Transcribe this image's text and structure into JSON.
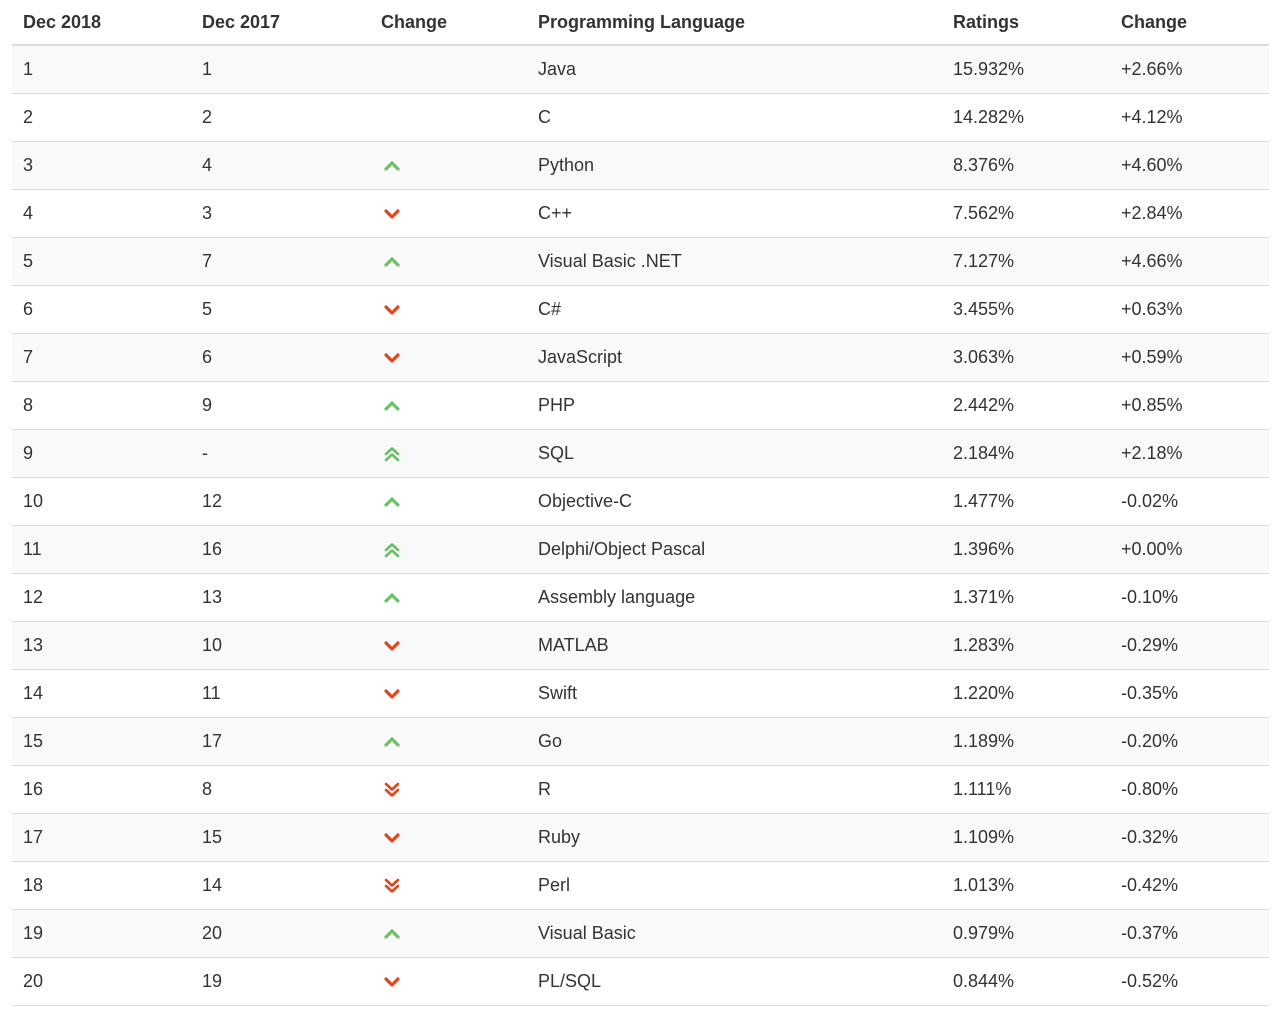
{
  "headers": [
    "Dec 2018",
    "Dec 2017",
    "Change",
    "Programming Language",
    "Ratings",
    "Change"
  ],
  "colors": {
    "up": "#6cbf6a",
    "down": "#e0461c"
  },
  "rows": [
    {
      "rank_2018": "1",
      "rank_2017": "1",
      "trend": "none",
      "language": "Java",
      "rating": "15.932%",
      "change": "+2.66%"
    },
    {
      "rank_2018": "2",
      "rank_2017": "2",
      "trend": "none",
      "language": "C",
      "rating": "14.282%",
      "change": "+4.12%"
    },
    {
      "rank_2018": "3",
      "rank_2017": "4",
      "trend": "up",
      "language": "Python",
      "rating": "8.376%",
      "change": "+4.60%"
    },
    {
      "rank_2018": "4",
      "rank_2017": "3",
      "trend": "down",
      "language": "C++",
      "rating": "7.562%",
      "change": "+2.84%"
    },
    {
      "rank_2018": "5",
      "rank_2017": "7",
      "trend": "up",
      "language": "Visual Basic .NET",
      "rating": "7.127%",
      "change": "+4.66%"
    },
    {
      "rank_2018": "6",
      "rank_2017": "5",
      "trend": "down",
      "language": "C#",
      "rating": "3.455%",
      "change": "+0.63%"
    },
    {
      "rank_2018": "7",
      "rank_2017": "6",
      "trend": "down",
      "language": "JavaScript",
      "rating": "3.063%",
      "change": "+0.59%"
    },
    {
      "rank_2018": "8",
      "rank_2017": "9",
      "trend": "up",
      "language": "PHP",
      "rating": "2.442%",
      "change": "+0.85%"
    },
    {
      "rank_2018": "9",
      "rank_2017": "-",
      "trend": "up-double",
      "language": "SQL",
      "rating": "2.184%",
      "change": "+2.18%"
    },
    {
      "rank_2018": "10",
      "rank_2017": "12",
      "trend": "up",
      "language": "Objective-C",
      "rating": "1.477%",
      "change": "-0.02%"
    },
    {
      "rank_2018": "11",
      "rank_2017": "16",
      "trend": "up-double",
      "language": "Delphi/Object Pascal",
      "rating": "1.396%",
      "change": "+0.00%"
    },
    {
      "rank_2018": "12",
      "rank_2017": "13",
      "trend": "up",
      "language": "Assembly language",
      "rating": "1.371%",
      "change": "-0.10%"
    },
    {
      "rank_2018": "13",
      "rank_2017": "10",
      "trend": "down",
      "language": "MATLAB",
      "rating": "1.283%",
      "change": "-0.29%"
    },
    {
      "rank_2018": "14",
      "rank_2017": "11",
      "trend": "down",
      "language": "Swift",
      "rating": "1.220%",
      "change": "-0.35%"
    },
    {
      "rank_2018": "15",
      "rank_2017": "17",
      "trend": "up",
      "language": "Go",
      "rating": "1.189%",
      "change": "-0.20%"
    },
    {
      "rank_2018": "16",
      "rank_2017": "8",
      "trend": "down-double",
      "language": "R",
      "rating": "1.111%",
      "change": "-0.80%"
    },
    {
      "rank_2018": "17",
      "rank_2017": "15",
      "trend": "down",
      "language": "Ruby",
      "rating": "1.109%",
      "change": "-0.32%"
    },
    {
      "rank_2018": "18",
      "rank_2017": "14",
      "trend": "down-double",
      "language": "Perl",
      "rating": "1.013%",
      "change": "-0.42%"
    },
    {
      "rank_2018": "19",
      "rank_2017": "20",
      "trend": "up",
      "language": "Visual Basic",
      "rating": "0.979%",
      "change": "-0.37%"
    },
    {
      "rank_2018": "20",
      "rank_2017": "19",
      "trend": "down",
      "language": "PL/SQL",
      "rating": "0.844%",
      "change": "-0.52%"
    }
  ]
}
